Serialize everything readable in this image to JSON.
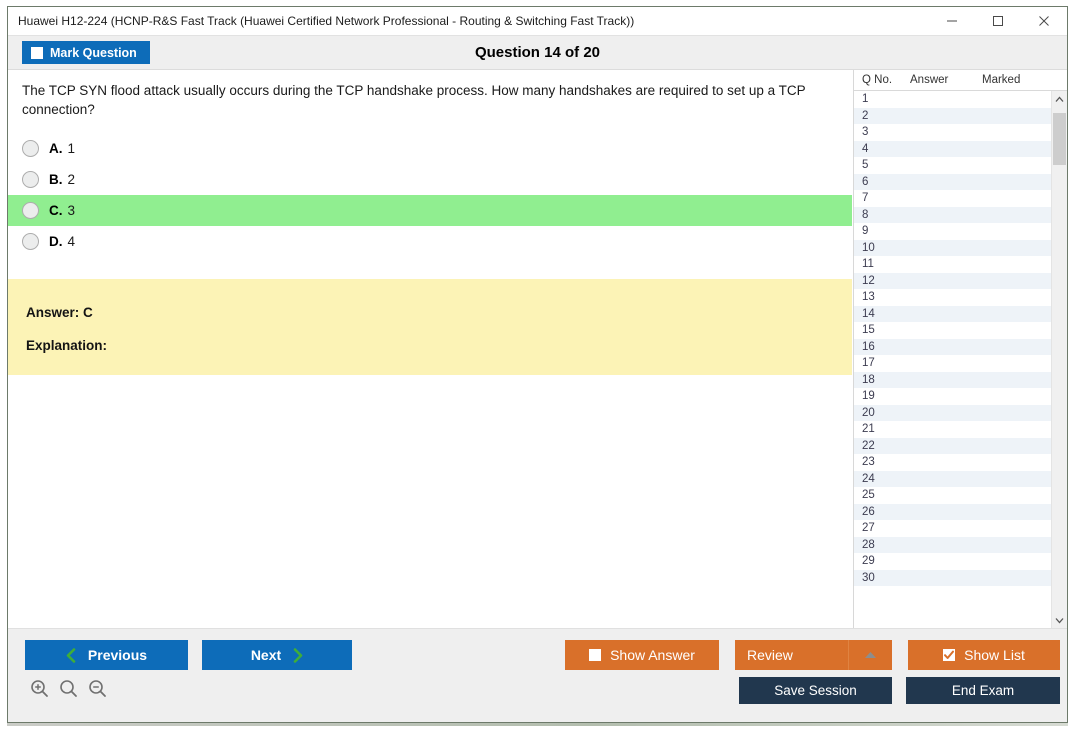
{
  "window": {
    "title": "Huawei H12-224 (HCNP-R&S Fast Track (Huawei Certified Network Professional - Routing & Switching Fast Track))",
    "controls": {
      "minimize": "minimize-icon",
      "maximize": "maximize-icon",
      "close": "close-icon"
    }
  },
  "header": {
    "mark_question_label": "Mark Question",
    "mark_question_checked": false,
    "question_counter": "Question 14 of 20"
  },
  "question": {
    "text": "The TCP SYN flood attack usually occurs during the TCP handshake process. How many handshakes are required to set up a TCP connection?",
    "options": [
      {
        "letter": "A.",
        "text": "1",
        "correct": false
      },
      {
        "letter": "B.",
        "text": "2",
        "correct": false
      },
      {
        "letter": "C.",
        "text": "3",
        "correct": true
      },
      {
        "letter": "D.",
        "text": "4",
        "correct": false
      }
    ],
    "answer_label": "Answer: C",
    "explanation_label": "Explanation:"
  },
  "question_list": {
    "columns": [
      "Q No.",
      "Answer",
      "Marked"
    ],
    "rows": [
      {
        "no": "1",
        "answer": "",
        "marked": ""
      },
      {
        "no": "2",
        "answer": "",
        "marked": ""
      },
      {
        "no": "3",
        "answer": "",
        "marked": ""
      },
      {
        "no": "4",
        "answer": "",
        "marked": ""
      },
      {
        "no": "5",
        "answer": "",
        "marked": ""
      },
      {
        "no": "6",
        "answer": "",
        "marked": ""
      },
      {
        "no": "7",
        "answer": "",
        "marked": ""
      },
      {
        "no": "8",
        "answer": "",
        "marked": ""
      },
      {
        "no": "9",
        "answer": "",
        "marked": ""
      },
      {
        "no": "10",
        "answer": "",
        "marked": ""
      },
      {
        "no": "11",
        "answer": "",
        "marked": ""
      },
      {
        "no": "12",
        "answer": "",
        "marked": ""
      },
      {
        "no": "13",
        "answer": "",
        "marked": ""
      },
      {
        "no": "14",
        "answer": "",
        "marked": ""
      },
      {
        "no": "15",
        "answer": "",
        "marked": ""
      },
      {
        "no": "16",
        "answer": "",
        "marked": ""
      },
      {
        "no": "17",
        "answer": "",
        "marked": ""
      },
      {
        "no": "18",
        "answer": "",
        "marked": ""
      },
      {
        "no": "19",
        "answer": "",
        "marked": ""
      },
      {
        "no": "20",
        "answer": "",
        "marked": ""
      },
      {
        "no": "21",
        "answer": "",
        "marked": ""
      },
      {
        "no": "22",
        "answer": "",
        "marked": ""
      },
      {
        "no": "23",
        "answer": "",
        "marked": ""
      },
      {
        "no": "24",
        "answer": "",
        "marked": ""
      },
      {
        "no": "25",
        "answer": "",
        "marked": ""
      },
      {
        "no": "26",
        "answer": "",
        "marked": ""
      },
      {
        "no": "27",
        "answer": "",
        "marked": ""
      },
      {
        "no": "28",
        "answer": "",
        "marked": ""
      },
      {
        "no": "29",
        "answer": "",
        "marked": ""
      },
      {
        "no": "30",
        "answer": "",
        "marked": ""
      }
    ]
  },
  "footer": {
    "previous_label": "Previous",
    "next_label": "Next",
    "show_answer_label": "Show Answer",
    "show_answer_checked": false,
    "review_label": "Review",
    "show_list_label": "Show List",
    "show_list_checked": true,
    "save_session_label": "Save Session",
    "end_exam_label": "End Exam",
    "zoom_icons": [
      "zoom-in-icon",
      "zoom-reset-icon",
      "zoom-out-icon"
    ]
  },
  "colors": {
    "primary_blue": "#0d6cb9",
    "orange": "#d9702a",
    "navy": "#21374e",
    "correct_green": "#90ee90",
    "answer_yellow": "#fcf3b6",
    "chevron_green": "#3fae38"
  }
}
